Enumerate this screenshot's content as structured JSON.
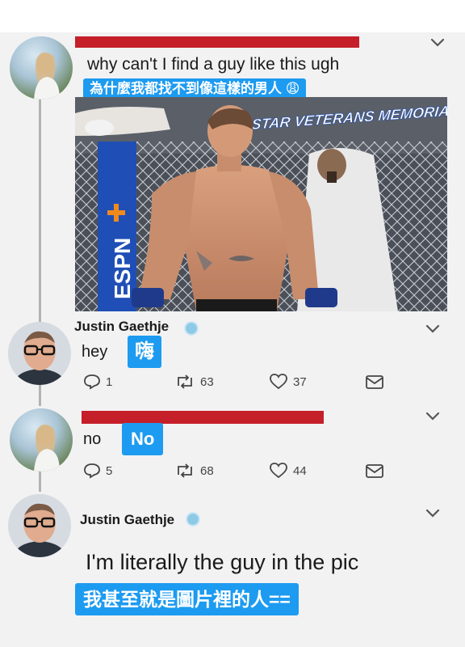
{
  "tweet1": {
    "text": "why can't I find a guy like this ugh",
    "subtitle": "為什麼我都找不到像這樣的男人 😩",
    "photo_banner": "STAR VETERANS MEMORIAL",
    "cage_logo": "ESPN"
  },
  "reply1": {
    "name": "Justin Gaethje",
    "text": "hey",
    "subtitle": "嗨",
    "replies": "1",
    "retweets": "63",
    "likes": "37"
  },
  "reply2": {
    "text": "no",
    "subtitle": "No",
    "replies": "5",
    "retweets": "68",
    "likes": "44"
  },
  "reply3": {
    "name": "Justin Gaethje",
    "text": "I'm literally the guy in the pic",
    "subtitle": "我甚至就是圖片裡的人=="
  },
  "icons": {
    "chevron": "chevron-down-icon",
    "reply": "reply-icon",
    "retweet": "retweet-icon",
    "like": "heart-icon",
    "dm": "message-icon",
    "verified": "verified-badge-icon"
  },
  "colors": {
    "accent": "#1d9bf0",
    "redacted": "#c51f2a"
  }
}
